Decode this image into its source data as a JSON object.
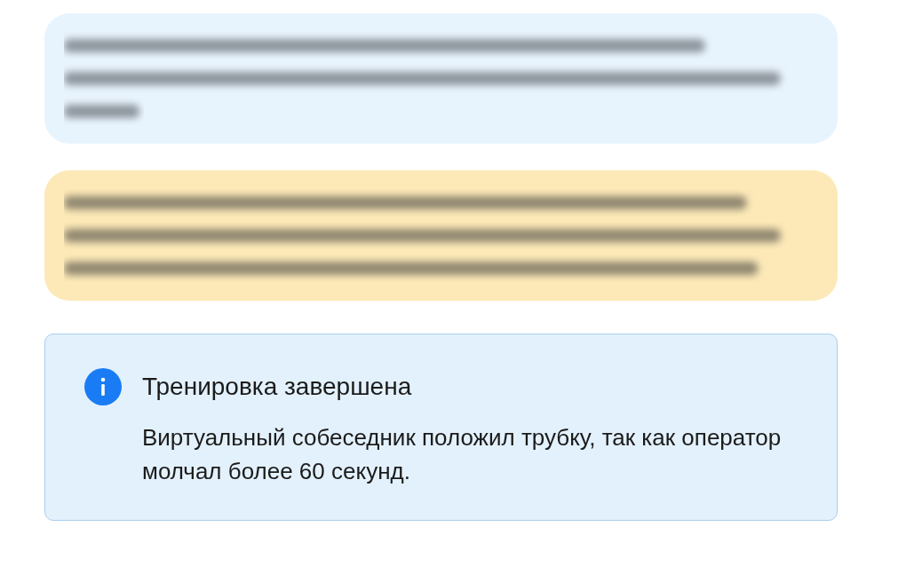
{
  "messages": [
    {
      "kind": "incoming",
      "blurred": true
    },
    {
      "kind": "outgoing",
      "blurred": true
    }
  ],
  "alert": {
    "kind": "info",
    "title": "Тренировка завершена",
    "text": "Виртуальный собеседник положил трубку, так как оператор молчал более 60 секунд."
  }
}
